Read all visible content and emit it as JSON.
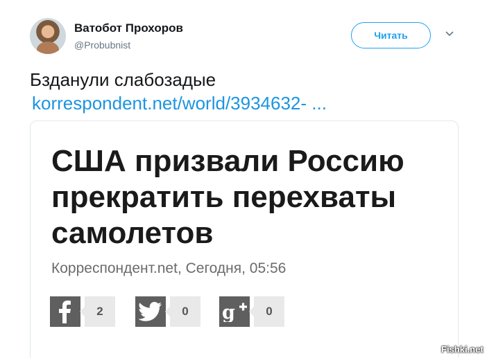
{
  "tweet": {
    "author_name": "Ватобот Прохоров",
    "author_handle": "@Probubnist",
    "follow_label": "Читать",
    "text": "Бзданули слабозадые",
    "link_text": "korrespondent.net/world/3934632-  ..."
  },
  "card": {
    "headline": "США призвали Россию прекратить перехваты самолетов",
    "meta": "Корреспондент.net, Сегодня, 05:56",
    "share": {
      "facebook_count": "2",
      "twitter_count": "0",
      "googleplus_count": "0"
    }
  },
  "watermark": "Fishki.net"
}
